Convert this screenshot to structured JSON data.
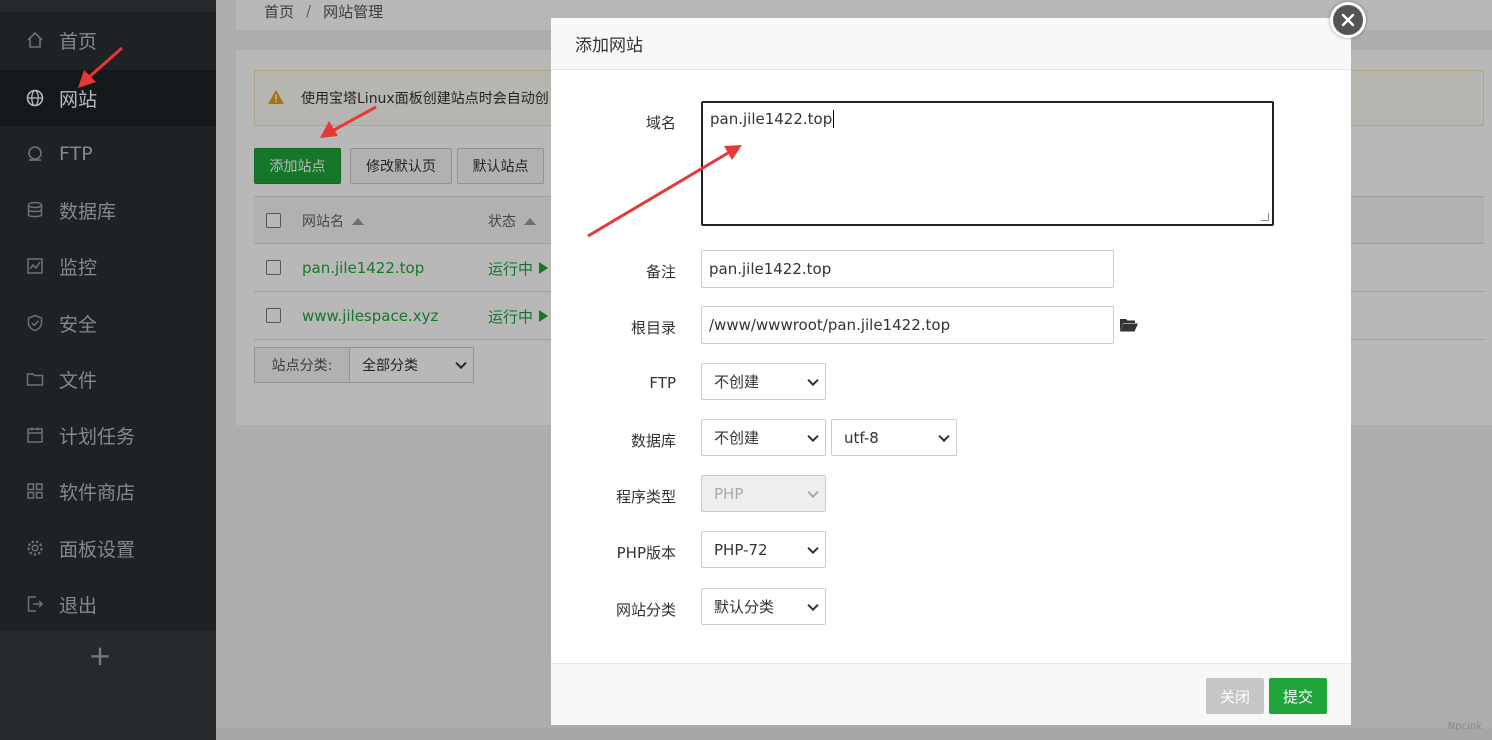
{
  "sidebar": {
    "items": [
      {
        "label": "首页",
        "icon": "home-icon"
      },
      {
        "label": "网站",
        "icon": "globe-icon"
      },
      {
        "label": "FTP",
        "icon": "ftp-icon"
      },
      {
        "label": "数据库",
        "icon": "database-icon"
      },
      {
        "label": "监控",
        "icon": "monitor-icon"
      },
      {
        "label": "安全",
        "icon": "shield-icon"
      },
      {
        "label": "文件",
        "icon": "folder-icon"
      },
      {
        "label": "计划任务",
        "icon": "calendar-icon"
      },
      {
        "label": "软件商店",
        "icon": "grid-icon"
      },
      {
        "label": "面板设置",
        "icon": "gear-icon"
      },
      {
        "label": "退出",
        "icon": "logout-icon"
      }
    ],
    "active_index": 1,
    "add_label": "+"
  },
  "breadcrumb": {
    "home": "首页",
    "sep": "/",
    "current": "网站管理"
  },
  "notice": {
    "text": "使用宝塔Linux面板创建站点时会自动创"
  },
  "toolbar": {
    "add_site": "添加站点",
    "edit_default": "修改默认页",
    "default_site": "默认站点"
  },
  "table": {
    "headers": {
      "name": "网站名",
      "status": "状态"
    },
    "rows": [
      {
        "name": "pan.jile1422.top",
        "status": "运行中"
      },
      {
        "name": "www.jilespace.xyz",
        "status": "运行中"
      }
    ]
  },
  "category": {
    "label": "站点分类:",
    "value": "全部分类"
  },
  "modal": {
    "title": "添加网站",
    "fields": {
      "domain_label": "域名",
      "domain_value": "pan.jile1422.top",
      "remark_label": "备注",
      "remark_value": "pan.jile1422.top",
      "root_label": "根目录",
      "root_value": "/www/wwwroot/pan.jile1422.top",
      "ftp_label": "FTP",
      "ftp_value": "不创建",
      "db_label": "数据库",
      "db_value": "不创建",
      "charset_value": "utf-8",
      "program_label": "程序类型",
      "program_value": "PHP",
      "php_label": "PHP版本",
      "php_value": "PHP-72",
      "sitecat_label": "网站分类",
      "sitecat_value": "默认分类"
    },
    "close_label": "关闭",
    "submit_label": "提交"
  },
  "watermark": "Npcink",
  "colors": {
    "accent": "#20a53a",
    "sidebar": "#2c3034",
    "annotation_arrow": "#e53935"
  }
}
